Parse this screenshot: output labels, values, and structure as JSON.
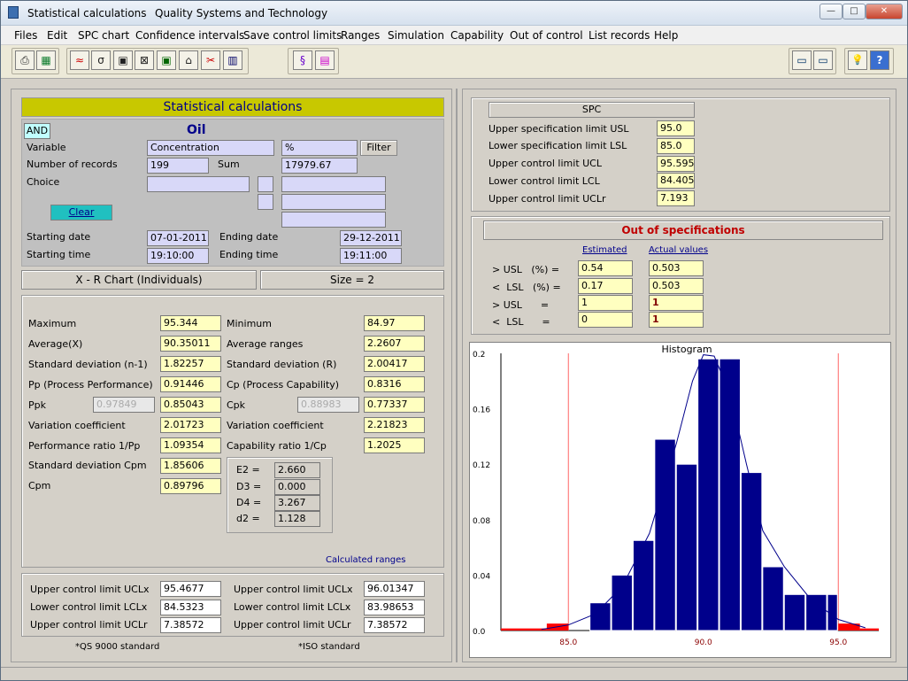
{
  "window": {
    "app_title": "Statistical calculations",
    "subtitle": "Quality Systems and Technology",
    "min_label": "—",
    "max_label": "□",
    "close_label": "✕"
  },
  "menu": [
    "Files",
    "Edit",
    "SPC chart",
    "Confidence intervals",
    "Save control limits",
    "Ranges",
    "Simulation",
    "Capability",
    "Out of control",
    "List records",
    "Help"
  ],
  "toolbar": {
    "icons": [
      "printer-icon",
      "excel-icon",
      "chart-icon",
      "sigma-icon",
      "save-icon",
      "delete-icon",
      "disk-icon",
      "bell-icon",
      "scissors-icon",
      "histogram-icon",
      "formula-icon",
      "calculator-icon",
      "monitor-icon",
      "screen-icon",
      "bulb-icon",
      "help-icon"
    ],
    "glyphs": [
      "⎙",
      "▦",
      "≈",
      "σ",
      "▣",
      "⊠",
      "▣",
      "⌂",
      "✂",
      "▥",
      "§",
      "▤",
      "▭",
      "▭",
      "💡",
      "?"
    ]
  },
  "left": {
    "header": "Statistical calculations",
    "and_label": "AND",
    "title": "Oil",
    "variable_label": "Variable",
    "variable_value": "Concentration",
    "unit_value": "%",
    "filter_label": "Filter",
    "records_label": "Number of records",
    "records_value": "199",
    "sum_label": "Sum",
    "sum_value": "17979.67",
    "choice_label": "Choice",
    "clear_label": "Clear",
    "start_date_label": "Starting date",
    "start_date": "07-01-2011",
    "end_date_label": "Ending date",
    "end_date": "29-12-2011",
    "start_time_label": "Starting time",
    "start_time": "19:10:00",
    "end_time_label": "Ending time",
    "end_time": "19:11:00",
    "chart_type": "X - R Chart (Individuals)",
    "size": "Size = 2"
  },
  "stats": {
    "maximum_label": "Maximum",
    "maximum": "95.344",
    "minimum_label": "Minimum",
    "minimum": "84.97",
    "average_label": "Average(X)",
    "average": "90.35011",
    "avg_ranges_label": "Average ranges",
    "avg_ranges": "2.2607",
    "sd_label": "Standard deviation (n-1)",
    "sd": "1.82257",
    "sdr_label": "Standard deviation (R)",
    "sdr": "2.00417",
    "pp_label": "Pp (Process Performance)",
    "pp": "0.91446",
    "cp_label": "Cp (Process Capability)",
    "cp": "0.8316",
    "ppk_label": "Ppk",
    "ppk_gray": "0.97849",
    "ppk": "0.85043",
    "cpk_label": "Cpk",
    "cpk_gray": "0.88983",
    "cpk": "0.77337",
    "vc1_label": "Variation coefficient",
    "vc1": "2.01723",
    "vc2_label": "Variation coefficient",
    "vc2": "2.21823",
    "perf_label": "Performance ratio 1/Pp",
    "perf": "1.09354",
    "capr_label": "Capability ratio 1/Cp",
    "capr": "1.2025",
    "sdcpm_label": "Standard deviation Cpm",
    "sdcpm": "1.85606",
    "cpm_label": "Cpm",
    "cpm": "0.89796",
    "consts": [
      {
        "label": "E2 =",
        "value": "2.660"
      },
      {
        "label": "D3 =",
        "value": "0.000"
      },
      {
        "label": "D4 =",
        "value": "3.267"
      },
      {
        "label": "d2 =",
        "value": "1.128"
      }
    ],
    "calc_ranges": "Calculated ranges"
  },
  "limits": {
    "qs": [
      {
        "label": "Upper control limit UCLx",
        "value": "95.4677"
      },
      {
        "label": "Lower control limit LCLx",
        "value": "84.5323"
      },
      {
        "label": "Upper control limit UCLr",
        "value": "7.38572"
      }
    ],
    "iso": [
      {
        "label": "Upper control limit UCLx",
        "value": "96.01347"
      },
      {
        "label": "Lower control limit LCLx",
        "value": "83.98653"
      },
      {
        "label": "Upper control limit UCLr",
        "value": "7.38572"
      }
    ],
    "qs_note": "*QS 9000 standard",
    "iso_note": "*ISO standard"
  },
  "spc": {
    "header": "SPC",
    "rows": [
      {
        "label": "Upper specification limit USL",
        "value": "95.0"
      },
      {
        "label": "Lower specification limit LSL",
        "value": "85.0"
      },
      {
        "label": "Upper control limit UCL",
        "value": "95.595"
      },
      {
        "label": "Lower control limit LCL",
        "value": "84.405"
      },
      {
        "label": "Upper control limit UCLr",
        "value": "7.193"
      }
    ]
  },
  "oos": {
    "header": "Out of specifications",
    "estimated_label": "Estimated",
    "actual_label": "Actual values",
    "rows": [
      {
        "label": "> USL   (%) =",
        "est": "0.54",
        "act": "0.503"
      },
      {
        "label": "<  LSL   (%) =",
        "est": "0.17",
        "act": "0.503"
      },
      {
        "label": "> USL      =",
        "est": "1",
        "act": "1"
      },
      {
        "label": "<  LSL      =",
        "est": "0",
        "act": "1"
      }
    ]
  },
  "colors": {
    "bar": "#00008b",
    "spec_bar": "#ff0000",
    "spec_line": "#ff6666",
    "header_yellow": "#c8c800",
    "field_yellow": "#ffffc0"
  },
  "chart_data": {
    "type": "bar",
    "title": "Histogram",
    "ylim": [
      0,
      0.2
    ],
    "xlim": [
      82.5,
      96.5
    ],
    "y_ticks": [
      "0.0",
      "0.04",
      "0.08",
      "0.12",
      "0.16",
      "0.2"
    ],
    "y_tick_values": [
      0,
      0.04,
      0.08,
      0.12,
      0.16,
      0.2
    ],
    "x_ticks": [
      "85.0",
      "90.0",
      "95.0"
    ],
    "x_tick_values": [
      85.0,
      90.0,
      95.0
    ],
    "spec_lines": [
      85.0,
      95.0
    ],
    "bars": [
      {
        "x0": 85.0,
        "x1": 85.8,
        "y": 0.0
      },
      {
        "x0": 85.8,
        "x1": 86.6,
        "y": 0.02
      },
      {
        "x0": 86.6,
        "x1": 87.4,
        "y": 0.04
      },
      {
        "x0": 87.4,
        "x1": 88.2,
        "y": 0.065
      },
      {
        "x0": 88.2,
        "x1": 89.0,
        "y": 0.138
      },
      {
        "x0": 89.0,
        "x1": 89.8,
        "y": 0.12
      },
      {
        "x0": 89.8,
        "x1": 90.6,
        "y": 0.196
      },
      {
        "x0": 90.6,
        "x1": 91.4,
        "y": 0.196
      },
      {
        "x0": 91.4,
        "x1": 92.2,
        "y": 0.114
      },
      {
        "x0": 92.2,
        "x1": 93.0,
        "y": 0.046
      },
      {
        "x0": 93.0,
        "x1": 93.8,
        "y": 0.026
      },
      {
        "x0": 93.8,
        "x1": 94.6,
        "y": 0.026
      },
      {
        "x0": 94.6,
        "x1": 95.0,
        "y": 0.026
      }
    ],
    "out_bars": [
      {
        "x0": 82.5,
        "x1": 84.2,
        "y": 0.0015
      },
      {
        "x0": 84.2,
        "x1": 85.0,
        "y": 0.005
      },
      {
        "x0": 95.0,
        "x1": 95.8,
        "y": 0.005
      },
      {
        "x0": 95.8,
        "x1": 96.5,
        "y": 0.0015
      }
    ],
    "curve": [
      [
        84.0,
        0.0008
      ],
      [
        85.0,
        0.004
      ],
      [
        86.0,
        0.012
      ],
      [
        87.0,
        0.032
      ],
      [
        88.0,
        0.07
      ],
      [
        89.0,
        0.135
      ],
      [
        89.6,
        0.18
      ],
      [
        90.0,
        0.199
      ],
      [
        90.4,
        0.198
      ],
      [
        91.0,
        0.17
      ],
      [
        91.6,
        0.12
      ],
      [
        92.2,
        0.072
      ],
      [
        93.0,
        0.046
      ],
      [
        94.0,
        0.022
      ],
      [
        95.0,
        0.008
      ],
      [
        96.0,
        0.002
      ]
    ]
  }
}
